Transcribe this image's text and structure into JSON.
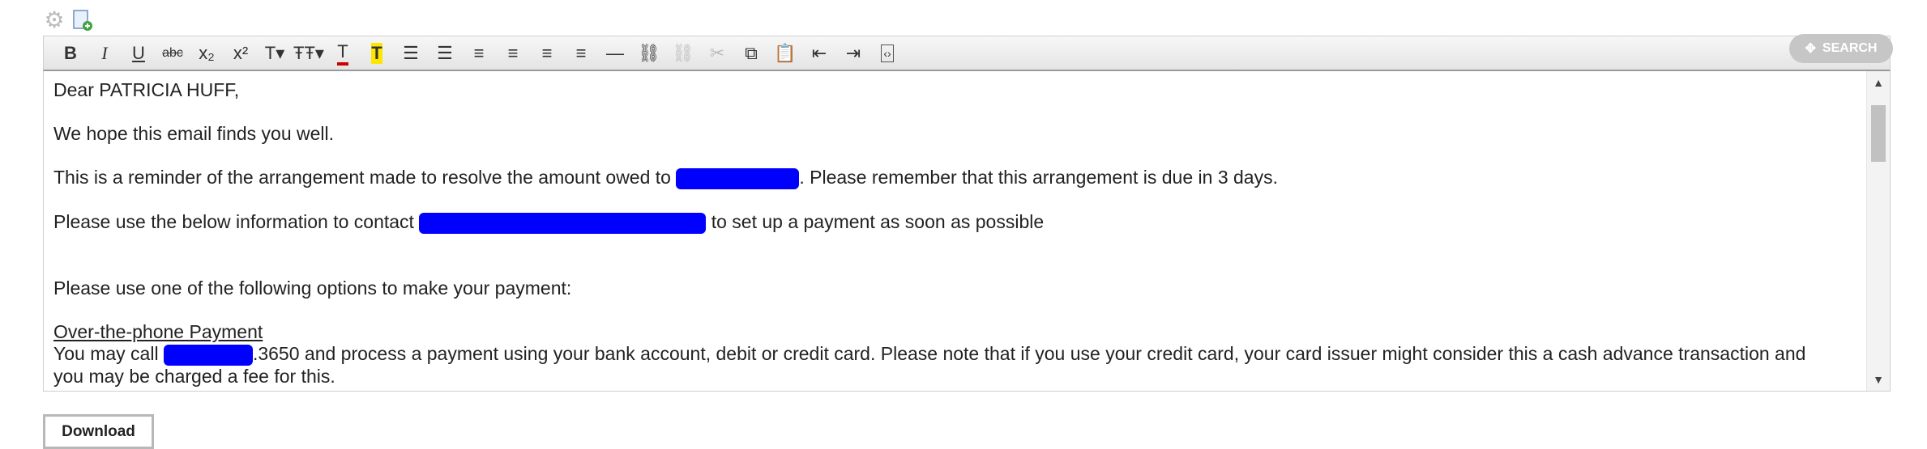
{
  "toolbar": {
    "buttons": [
      {
        "name": "bold-button",
        "label": "B"
      },
      {
        "name": "italic-button",
        "label": "I"
      },
      {
        "name": "underline-button",
        "label": "U"
      },
      {
        "name": "strikethrough-button",
        "label": "abc"
      },
      {
        "name": "subscript-button",
        "label": "x₂"
      },
      {
        "name": "superscript-button",
        "label": "x²"
      },
      {
        "name": "font-size-button",
        "label": "T▾"
      },
      {
        "name": "font-family-button",
        "label": "ŦŦ▾"
      },
      {
        "name": "text-color-button",
        "label": "T"
      },
      {
        "name": "highlight-button",
        "label": "T"
      },
      {
        "name": "bulleted-list-button",
        "label": "☰"
      },
      {
        "name": "numbered-list-button",
        "label": "☰"
      },
      {
        "name": "align-left-button",
        "label": "≡"
      },
      {
        "name": "align-center-button",
        "label": "≡"
      },
      {
        "name": "align-right-button",
        "label": "≡"
      },
      {
        "name": "justify-button",
        "label": "≡"
      },
      {
        "name": "horizontal-rule-button",
        "label": "—"
      },
      {
        "name": "insert-link-button",
        "label": "⛓"
      },
      {
        "name": "unlink-button",
        "label": "⛓"
      },
      {
        "name": "cut-button",
        "label": "✂"
      },
      {
        "name": "copy-button",
        "label": "⧉"
      },
      {
        "name": "paste-button",
        "label": "📋"
      },
      {
        "name": "outdent-button",
        "label": "⇤"
      },
      {
        "name": "indent-button",
        "label": "⇥"
      },
      {
        "name": "html-source-button",
        "label": "‹›"
      }
    ],
    "search_label": "SEARCH"
  },
  "email": {
    "greeting": "Dear PATRICIA HUFF,",
    "line1": "We hope this email finds you well.",
    "line2_pre": "This is a reminder of the arrangement made to resolve the amount owed to ",
    "line2_post": ". Please remember that this arrangement is due in 3 days.",
    "line3_pre": "Please use the below information to contact ",
    "line3_post": " to set up a payment as soon as possible",
    "line4": "Please use one of the following options to make your payment:",
    "phone_heading": "Over-the-phone Payment",
    "line5_pre": "You may call ",
    "line5_post": ".3650 and process a payment using your bank account, debit or credit card. Please note that if you use your credit card, your card issuer might consider this a cash advance transaction and",
    "line6": "you may be charged a fee for this."
  },
  "download_label": "Download",
  "colors": {
    "redaction": "#0000ff",
    "toolbar_bg": "#ececec",
    "search_bg": "#c6c6c6"
  }
}
